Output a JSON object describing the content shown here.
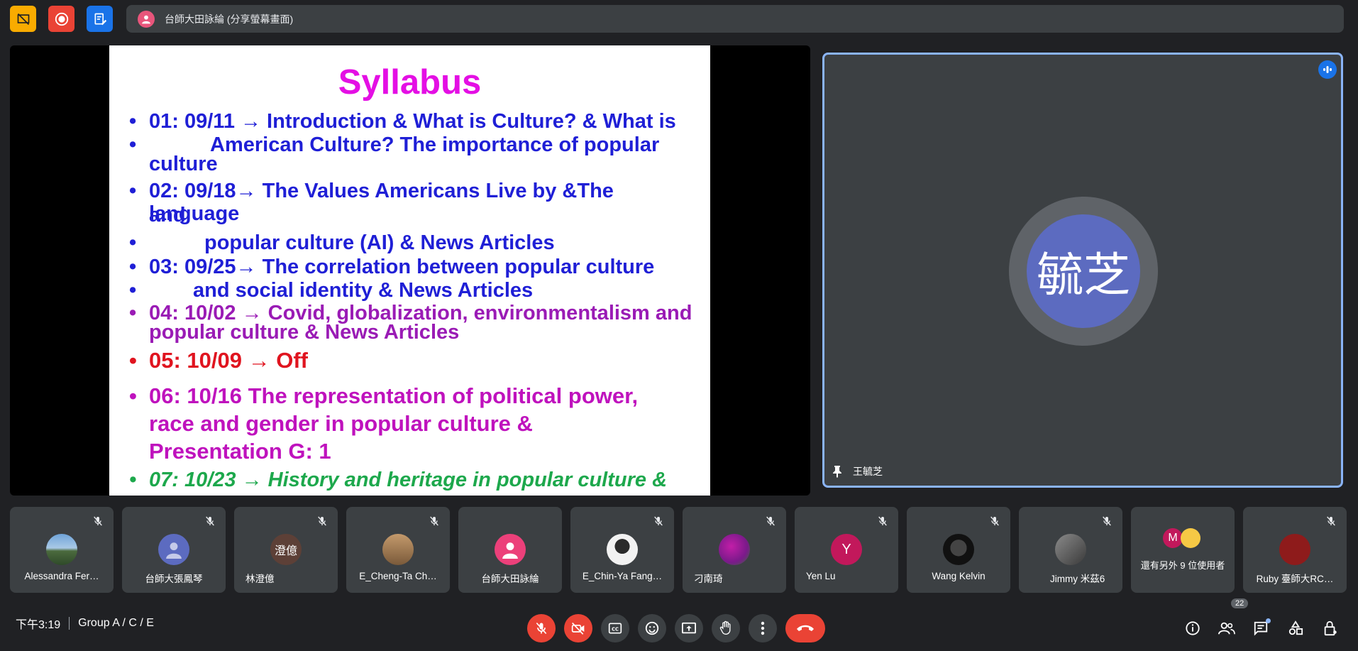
{
  "top_bar": {
    "presenter_label": "台師大田詠綸 (分享螢幕畫面)"
  },
  "slide": {
    "title": "Syllabus",
    "lines": [
      {
        "text": "01: 09/11 → Introduction & What is Culture? & What is"
      },
      {
        "text": "American Culture? The importance of popular"
      },
      {
        "text": "culture"
      },
      {
        "text": "02: 09/18→ The Values Americans Live by &The language"
      },
      {
        "text": "and"
      },
      {
        "text": "popular culture (AI) & News Articles"
      },
      {
        "text": "03: 09/25→ The correlation between popular culture"
      },
      {
        "text": "and social identity & News Articles"
      },
      {
        "text": "04: 10/02 → Covid, globalization, environmentalism and"
      },
      {
        "text": "popular culture & News Articles"
      },
      {
        "text": "05: 10/09 → Off"
      },
      {
        "text": "06: 10/16 The representation of political power,"
      },
      {
        "text": "race and gender in popular culture &"
      },
      {
        "text": "Presentation G: 1"
      },
      {
        "text": "07: 10/23 → History and heritage in popular culture &"
      }
    ]
  },
  "spotlight": {
    "avatar_text": "毓芝",
    "name": "王毓芝"
  },
  "participants": [
    {
      "name": "Alessandra Fer…",
      "avatar": "",
      "muted": true
    },
    {
      "name": "台師大張鳳琴",
      "avatar": "",
      "muted": true
    },
    {
      "name": "林澄億",
      "avatar": "澄億",
      "muted": true
    },
    {
      "name": "E_Cheng-Ta Ch…",
      "avatar": "",
      "muted": true
    },
    {
      "name": "台師大田詠綸",
      "avatar": "",
      "muted": false
    },
    {
      "name": "E_Chin-Ya Fang…",
      "avatar": "",
      "muted": true
    },
    {
      "name": "刁南琦",
      "avatar": "",
      "muted": true
    },
    {
      "name": "Yen Lu",
      "avatar": "Y",
      "muted": true
    },
    {
      "name": "Wang Kelvin",
      "avatar": "",
      "muted": true
    },
    {
      "name": "Jimmy 米茲6",
      "avatar": "",
      "muted": true
    },
    {
      "name": "還有另外 9 位使用者",
      "avatar": "M",
      "muted": false
    },
    {
      "name": "Ruby 臺師大RC…",
      "avatar": "",
      "muted": true
    }
  ],
  "bottom_bar": {
    "time": "下午3:19",
    "meeting_name": "Group A / C / E",
    "people_count": "22"
  },
  "colors": {
    "background": "#202124",
    "tile": "#3c4043",
    "danger": "#ea4335",
    "spotlight_border": "#8ab4f8"
  }
}
